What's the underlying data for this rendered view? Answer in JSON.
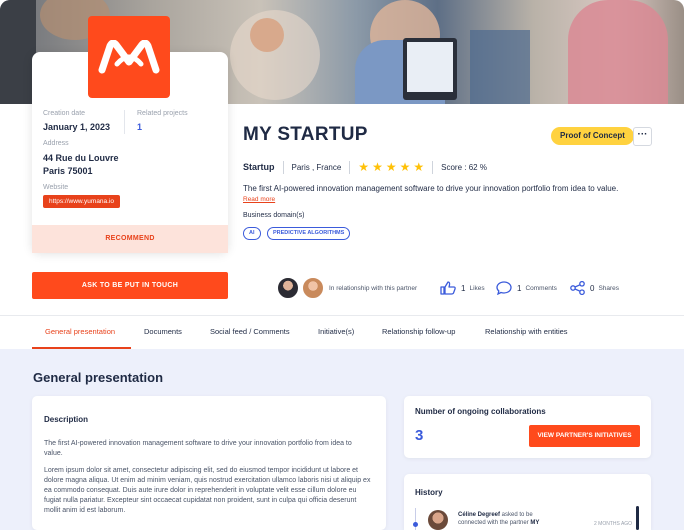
{
  "profile": {
    "logo_name": "yumana-logo",
    "creation_date_label": "Creation date",
    "creation_date": "January 1, 2023",
    "related_projects_label": "Related projects",
    "related_projects": "1",
    "address_label": "Address",
    "address_line1": "44 Rue du Louvre",
    "address_line2": "Paris 75001",
    "website_label": "Website",
    "website": "https://www.yumana.io",
    "recommend_label": "RECOMMEND",
    "touch_label": "ASK TO BE PUT IN TOUCH"
  },
  "header": {
    "title": "MY STARTUP",
    "badge": "Proof of Concept",
    "more_label": "···",
    "type": "Startup",
    "location": "Paris , France",
    "rating": 5,
    "score": "Score : 62 %",
    "description": "The first AI-powered innovation management software to drive your innovation portfolio from idea to value.",
    "read_more": "Read more",
    "domains_label": "Business domain(s)",
    "tags": [
      "AI",
      "PREDICTIVE ALGORITHMS"
    ]
  },
  "relationship": {
    "text": "In relationship with this partner",
    "likes_count": "1",
    "likes_label": "Likes",
    "comments_count": "1",
    "comments_label": "Comments",
    "shares_count": "0",
    "shares_label": "Shares"
  },
  "tabs": [
    "General presentation",
    "Documents",
    "Social feed / Comments",
    "Initiative(s)",
    "Relationship follow-up",
    "Relationship with entities"
  ],
  "active_tab": "General presentation",
  "content": {
    "section_title": "General presentation",
    "description_heading": "Description",
    "description_p1": "The first AI-powered innovation management software to drive your innovation portfolio from idea to value.",
    "description_p2": "Lorem ipsum dolor sit amet, consectetur adipiscing elit, sed do eiusmod tempor incididunt ut labore et dolore magna aliqua. Ut enim ad minim veniam, quis nostrud exercitation ullamco laboris nisi ut aliquip ex ea commodo consequat. Duis aute irure dolor in reprehenderit in voluptate velit esse cillum dolore eu fugiat nulla pariatur. Excepteur sint occaecat cupidatat non proident, sunt in culpa qui officia deserunt mollit anim id est laborum.",
    "collab_heading": "Number of ongoing collaborations",
    "collab_count": "3",
    "view_initiatives": "VIEW PARTNER'S INITIATIVES",
    "history_heading": "History",
    "history_name": "Céline Degreef",
    "history_text_mid": " asked to be connected with the partner ",
    "history_text_end": "MY",
    "history_date": "2 MONTHS AGO"
  },
  "colors": {
    "accent": "#ff4a1c",
    "link": "#3b5bdb",
    "badge": "#ffd23f",
    "star": "#ffc107",
    "content_bg": "#edf0fb"
  }
}
